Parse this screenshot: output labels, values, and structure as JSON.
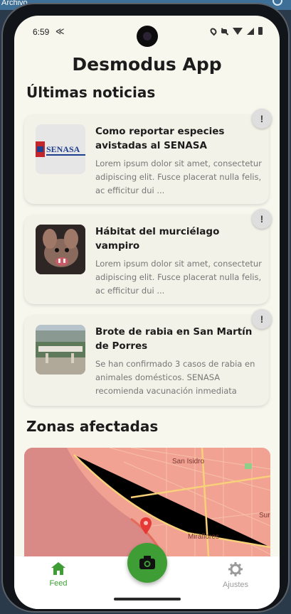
{
  "desktop": {
    "window_label": "Archivo"
  },
  "status_bar": {
    "time": "6:59",
    "icons": [
      "flutter-icon",
      "location-icon",
      "mute-icon",
      "wifi-icon",
      "signal-icon",
      "battery-icon"
    ]
  },
  "app": {
    "title": "Desmodus App"
  },
  "news": {
    "heading": "Últimas noticias",
    "items": [
      {
        "title": "Como reportar especies avistadas al SENASA",
        "body": "Lorem ipsum dolor sit amet, consectetur adipiscing elit. Fusce placerat nulla felis, ac efficitur dui ...",
        "image": "senasa-logo",
        "logo_text": "SENASA",
        "alert_label": "!"
      },
      {
        "title": "Hábitat del murciélago vampiro",
        "body": "Lorem ipsum dolor sit amet, consectetur adipiscing elit. Fusce placerat nulla felis, ac efficitur dui ...",
        "image": "vampire-bat-photo",
        "alert_label": "!"
      },
      {
        "title": "Brote de rabia en San Martín de Porres",
        "body": "Se han confirmado 3 casos de rabia en animales domésticos. SENASA recomienda vacunación inmediata",
        "image": "san-martin-street-photo",
        "alert_label": "!"
      }
    ]
  },
  "zones": {
    "heading": "Zonas afectadas",
    "map_labels": [
      "San Isidro",
      "Miraflores",
      "Sur"
    ]
  },
  "bottom_nav": {
    "items": [
      {
        "label": "Feed",
        "icon": "home-icon",
        "active": true
      },
      {
        "label": "Ajustes",
        "icon": "gear-icon",
        "active": false
      }
    ],
    "fab_icon": "camera-icon"
  },
  "colors": {
    "accent": "#3e9e35",
    "background": "#f7f7ee",
    "card": "#f2f2e8",
    "map_overlay": "#ef9a8a",
    "inactive": "#9a9a9a"
  }
}
